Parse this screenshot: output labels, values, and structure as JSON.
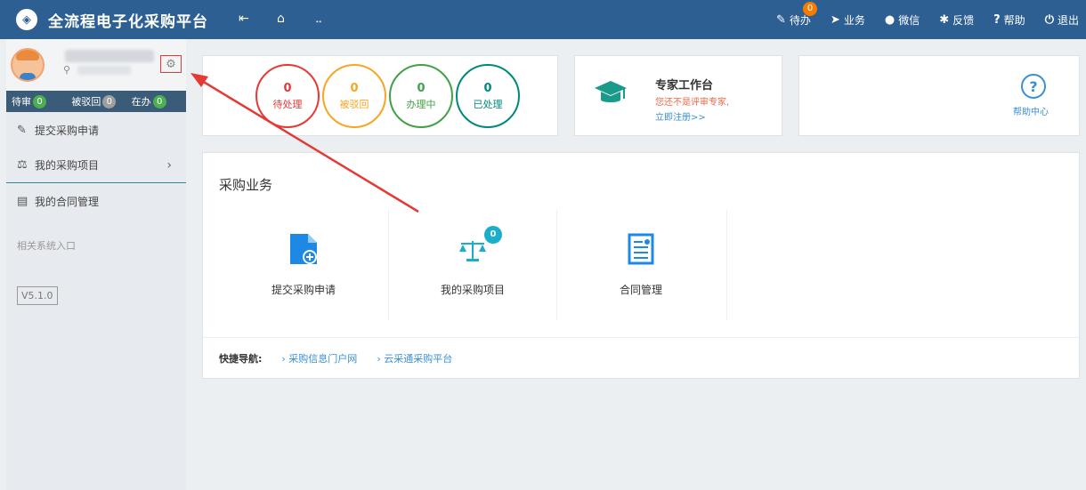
{
  "header": {
    "title": "全流程电子化采购平台",
    "nav": [
      {
        "label": "待办",
        "icon": "edit-icon",
        "badge": "0"
      },
      {
        "label": "业务",
        "icon": "send-icon"
      },
      {
        "label": "微信",
        "icon": "wechat-icon"
      },
      {
        "label": "反馈",
        "icon": "bug-icon"
      },
      {
        "label": "帮助",
        "icon": "question-icon"
      },
      {
        "label": "退出",
        "icon": "power-icon"
      }
    ]
  },
  "sidebar": {
    "status": [
      {
        "label": "待审",
        "count": "0"
      },
      {
        "label": "被驳回",
        "count": "0"
      },
      {
        "label": "在办",
        "count": "0"
      }
    ],
    "menu": [
      {
        "label": "提交采购申请",
        "icon": "edit-square-icon"
      },
      {
        "label": "我的采购项目",
        "icon": "scale-icon"
      },
      {
        "label": "我的合同管理",
        "icon": "contract-icon"
      }
    ],
    "section_label": "相关系统入口",
    "version": "V5.1.0"
  },
  "status_card": {
    "items": [
      {
        "num": "0",
        "label": "待处理",
        "color": "#e53935"
      },
      {
        "num": "0",
        "label": "被驳回",
        "color": "#f5a623"
      },
      {
        "num": "0",
        "label": "办理中",
        "color": "#43a047"
      },
      {
        "num": "0",
        "label": "已处理",
        "color": "#00897b"
      }
    ]
  },
  "expert": {
    "title": "专家工作台",
    "desc": "您还不是评审专家,",
    "link": "立即注册>>"
  },
  "help": {
    "label": "帮助中心"
  },
  "business": {
    "title": "采购业务",
    "items": [
      {
        "label": "提交采购申请",
        "icon": "file-add-icon"
      },
      {
        "label": "我的采购项目",
        "icon": "scale-icon",
        "badge": "0"
      },
      {
        "label": "合同管理",
        "icon": "contract-icon"
      }
    ]
  },
  "quick_nav": {
    "title": "快捷导航:",
    "links": [
      "› 采购信息门户网",
      "› 云采通采购平台"
    ]
  },
  "colors": {
    "header_bg": "#2d5f92",
    "accent": "#3a8fd6",
    "sidebar_bar": "#3b5c78",
    "annotation": "#e53935"
  }
}
